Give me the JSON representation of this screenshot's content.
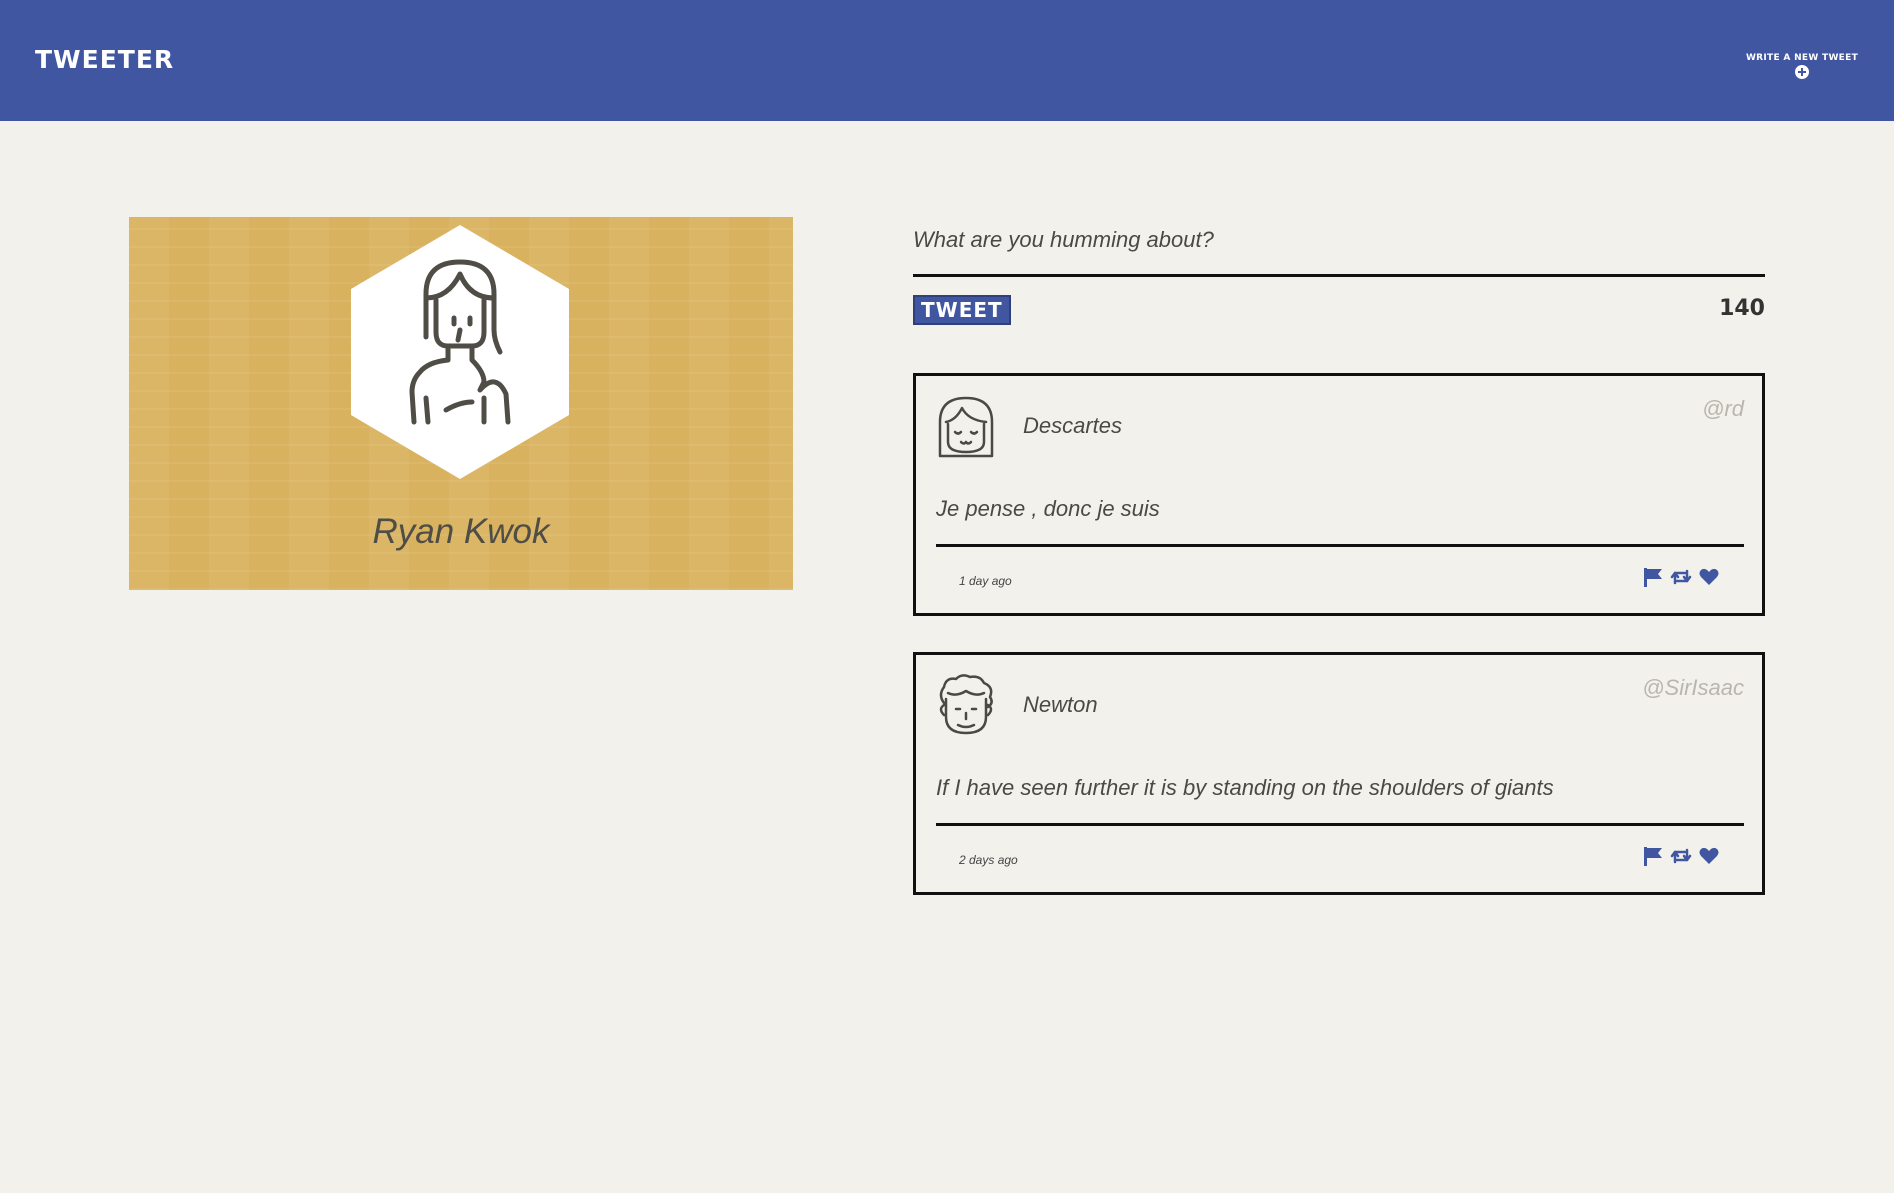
{
  "nav": {
    "brand": "TWEETER",
    "compose_label": "WRITE A NEW TWEET"
  },
  "profile": {
    "name": "Ryan Kwok",
    "avatar_icon": "woman-avatar-icon"
  },
  "composer": {
    "placeholder": "What are you humming about?",
    "button_label": "TWEET",
    "char_count": "140"
  },
  "tweets": [
    {
      "author": "Descartes",
      "handle": "@rd",
      "text": "Je pense , donc je suis",
      "time": "1 day ago",
      "avatar_icon": "girl-face-icon"
    },
    {
      "author": "Newton",
      "handle": "@SirIsaac",
      "text": "If I have seen further it is by standing on the shoulders of giants",
      "time": "2 days ago",
      "avatar_icon": "curly-hair-face-icon"
    }
  ],
  "action_icons": [
    "flag-icon",
    "retweet-icon",
    "heart-icon"
  ],
  "colors": {
    "nav_bg": "#4056a1",
    "page_bg": "#f3f1ec",
    "profile_bg": "#d8b25e",
    "accent": "#4056a1",
    "text": "#4a4a44",
    "muted": "#b8b6ae"
  }
}
